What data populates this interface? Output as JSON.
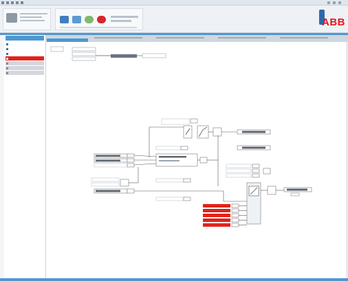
{
  "app": {
    "brand": "ABB",
    "brand_color": "#e0191f",
    "accent": "#4f97d1",
    "alarm_color": "#e2231a"
  },
  "toolbar": {
    "groups": [
      "device-group",
      "tools-group",
      "status-group"
    ],
    "icons": [
      "monitor-icon",
      "refresh-icon",
      "settings-icon",
      "stop-icon",
      "battery-icon"
    ]
  },
  "sidebar": {
    "items": [
      {
        "kind": "normal"
      },
      {
        "kind": "normal"
      },
      {
        "kind": "normal"
      },
      {
        "kind": "active"
      },
      {
        "kind": "grey"
      },
      {
        "kind": "grey"
      },
      {
        "kind": "grey"
      }
    ]
  },
  "diagram": {
    "alarm_rows": 5,
    "icons": [
      "switch-icon",
      "filter-icon",
      "ramp-icon",
      "limiter-icon",
      "summing-icon"
    ]
  }
}
